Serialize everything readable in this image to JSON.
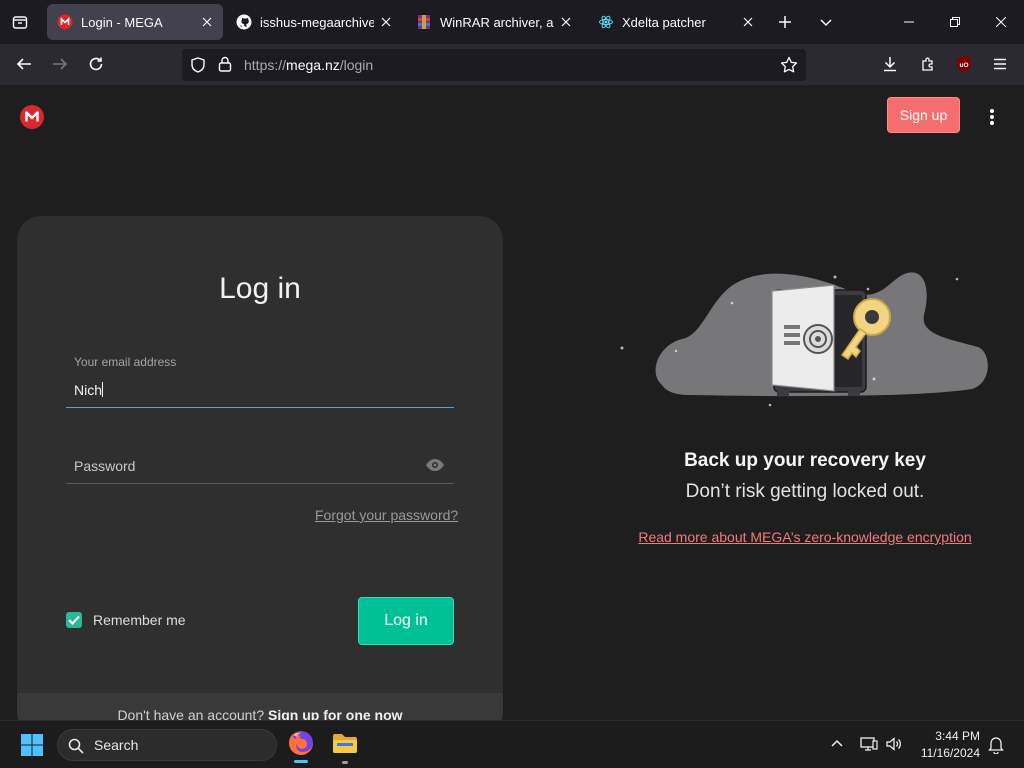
{
  "browser": {
    "tabs": [
      {
        "title": "Login - MEGA"
      },
      {
        "title": "isshus-megaarchive/W"
      },
      {
        "title": "WinRAR archiver, a po"
      },
      {
        "title": "Xdelta patcher"
      }
    ],
    "url_prefix": "https://",
    "url_host": "mega.nz",
    "url_path": "/login"
  },
  "header": {
    "signup_label": "Sign up"
  },
  "login": {
    "title": "Log in",
    "email_label": "Your email address",
    "email_value": "Nich",
    "password_placeholder": "Password",
    "forgot_label": "Forgot your password?",
    "remember_label": "Remember me",
    "remember_checked": true,
    "submit_label": "Log in",
    "footer_question": "Don't have an account?",
    "footer_link": "Sign up for one now"
  },
  "promo": {
    "title": "Back up your recovery key",
    "subtitle": "Don’t risk getting locked out.",
    "link": "Read more about MEGA’s zero-knowledge encryption"
  },
  "taskbar": {
    "search_label": "Search",
    "time": "3:44 PM",
    "date": "11/16/2024"
  },
  "colors": {
    "accent_green": "#00c196",
    "brand_red": "#d9272e",
    "signup_red": "#f46e6e"
  }
}
